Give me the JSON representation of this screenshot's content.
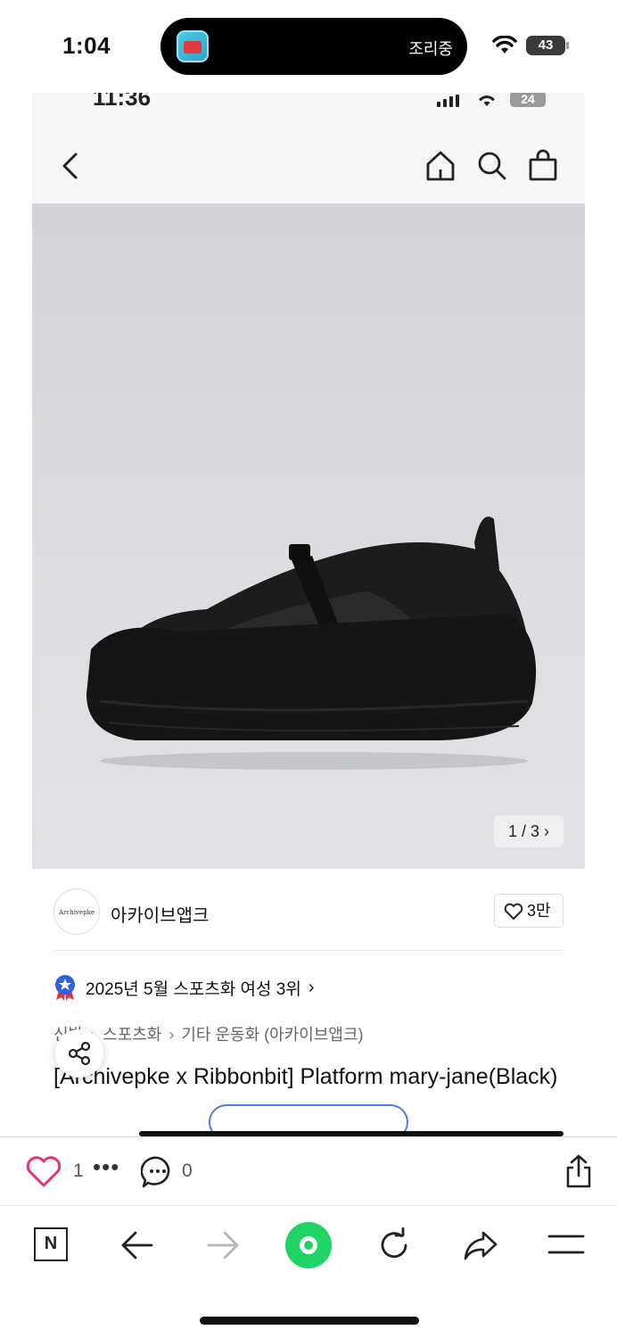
{
  "status_bar": {
    "time": "1:04",
    "live_activity_label": "조리중",
    "battery": "43"
  },
  "embedded": {
    "status": {
      "time": "11:36",
      "battery": "24"
    },
    "product": {
      "pager": "1 / 3 ›",
      "seller_logo_text": "Archivepke",
      "seller_name": "아카이브앱크",
      "like_count": "3만",
      "rank_text": "2025년 5월 스포츠화 여성 3위",
      "breadcrumbs": [
        "신발",
        "스포츠화",
        "기타 운동화 (아카이브앱크)"
      ],
      "breadcrumb_sep": "›",
      "title": "[Archivepke x Ribbonbit] Platform mary-jane(Black)"
    }
  },
  "action_bar": {
    "likes": "1",
    "more": "•••",
    "comments": "0"
  },
  "nav_bar": {
    "n_logo": "N"
  },
  "colors": {
    "heart": "#e8336b",
    "green_button": "#1fd364",
    "outline_pill": "#4a7fe6"
  }
}
